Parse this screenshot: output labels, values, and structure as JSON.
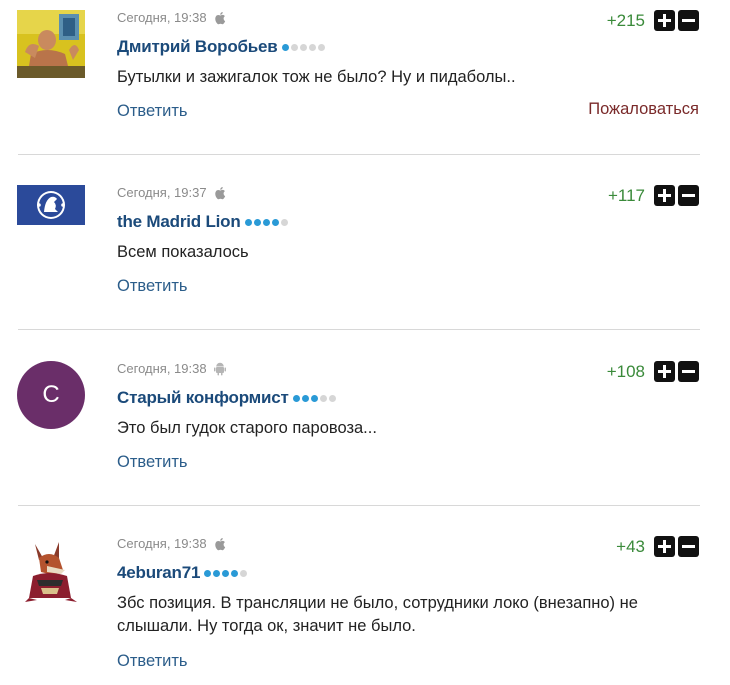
{
  "comments": [
    {
      "time": "Сегодня, 19:38",
      "device_icon": "apple-icon",
      "author": "Дмитрий Воробьев",
      "rating_dots": 1,
      "score": "+215",
      "text": "Бутылки и зажигалок тож не было? Ну и пидаболы..",
      "reply_label": "Ответить",
      "complain_label": "Пожаловаться",
      "avatar_icon": "user-photo-avatar"
    },
    {
      "time": "Сегодня, 19:37",
      "device_icon": "apple-icon",
      "author": "the Madrid Lion",
      "rating_dots": 4,
      "score": "+117",
      "text": "Всем показалось",
      "reply_label": "Ответить",
      "avatar_icon": "chelsea-crest-avatar"
    },
    {
      "time": "Сегодня, 19:38",
      "device_icon": "android-icon",
      "author": "Старый конформист",
      "rating_dots": 3,
      "score": "+108",
      "text": "Это был гудок старого паровоза...",
      "reply_label": "Ответить",
      "avatar_letter": "С",
      "avatar_color": "#6a2e69"
    },
    {
      "time": "Сегодня, 19:38",
      "device_icon": "apple-icon",
      "author": "4eburan71",
      "rating_dots": 4,
      "score": "+43",
      "text": "Збс позиция. В трансляции не было, сотрудники локо (внезапно) не слышали. Ну тогда ок, значит не было.",
      "reply_label": "Ответить",
      "avatar_icon": "coyote-mascot-avatar"
    }
  ],
  "colors": {
    "author": "#1b4a7a",
    "score": "#3a8a3a",
    "reply": "#2b5d8a",
    "complain": "#7a2a2a",
    "rating_on": "#2a9ad6",
    "rating_off": "#d6d6d6"
  },
  "icons": {
    "plus": "plus-icon",
    "minus": "minus-icon"
  }
}
